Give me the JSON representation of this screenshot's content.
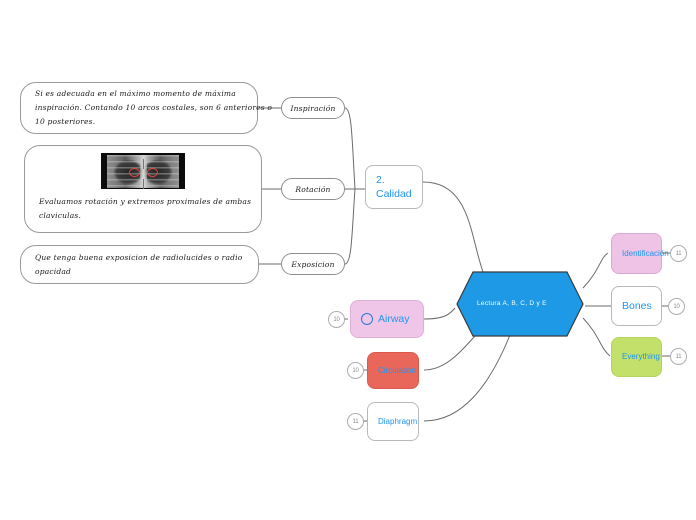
{
  "document": {
    "type": "mindmap",
    "background": "#ffffff"
  },
  "colors": {
    "accent_blue": "#2196f3",
    "hexagon_fill": "#1e99e5",
    "hexagon_stroke": "#3b3b3b",
    "pink": "#eec3e6",
    "red": "#e8675a",
    "green": "#c2e06a",
    "line": "#6b6b6b",
    "badge_text": "#8a8a8a"
  },
  "central": {
    "label": "Lectura A, B, C, D y E",
    "shape": "hexagon"
  },
  "branches": {
    "quality": {
      "label_line1": "2.",
      "label_line2": "Calidad",
      "children": [
        {
          "label": "Inspiración",
          "note": {
            "lines": [
              "Si es adecuada en el máximo momento de máxima",
              "inspiración. Contando 10 arcos costales, son 6 anteriores o",
              "10 posteriores."
            ]
          }
        },
        {
          "label": "Rotación",
          "note": {
            "image": "chest-xray-thumbnail",
            "lines": [
              "Evaluamos rotación y extremos proximales de ambas",
              "claviculas."
            ]
          }
        },
        {
          "label": "Exposicion",
          "note": {
            "lines": [
              "Que tenga buena exposicion de radiolucides o radio",
              "opacidad"
            ]
          }
        }
      ]
    },
    "left_items": [
      {
        "label": "Airway",
        "badge": "10",
        "fill": "pink",
        "icon": "circle-icon"
      },
      {
        "label": "Circulation",
        "badge": "10",
        "fill": "red",
        "icon": null
      },
      {
        "label": "Diaphragm",
        "badge": "11",
        "fill": "white",
        "icon": null
      }
    ],
    "right_items": [
      {
        "label": "Identificación",
        "badge": "11",
        "fill": "pink"
      },
      {
        "label": "Bones",
        "badge": "10",
        "fill": "white"
      },
      {
        "label": "Everything",
        "badge": "11",
        "fill": "green"
      }
    ]
  }
}
